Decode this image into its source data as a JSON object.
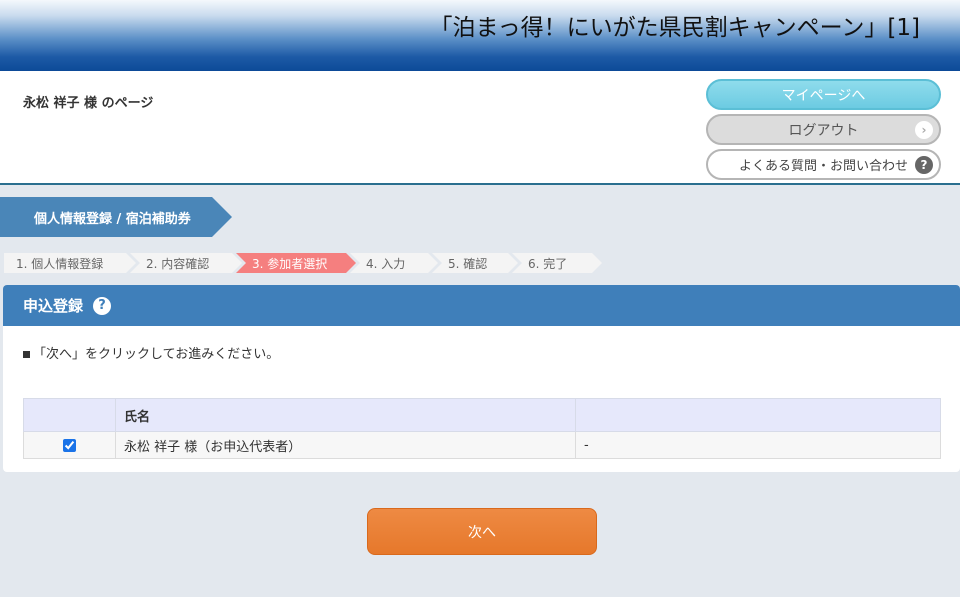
{
  "header": {
    "title": "「泊まっ得！にいがた県民割キャンペーン」[1]"
  },
  "user": {
    "name_label": "永松 祥子 様 のページ",
    "mypage_button": "マイページへ",
    "logout_button": "ログアウト",
    "faq_button": "よくある質問・お問い合わせ"
  },
  "section": {
    "label": "個人情報登録 / 宿泊補助券"
  },
  "steps": [
    {
      "label": "1. 個人情報登録"
    },
    {
      "label": "2. 内容確認"
    },
    {
      "label": "3. 参加者選択",
      "active": true
    },
    {
      "label": "4. 入力"
    },
    {
      "label": "5. 確認"
    },
    {
      "label": "6. 完了"
    }
  ],
  "form": {
    "title": "申込登録",
    "instruction": "「次へ」をクリックしてお進みください。",
    "columns": [
      "",
      "氏名",
      ""
    ],
    "rows": [
      {
        "checked": true,
        "name": "永松 祥子 様（お申込代表者）",
        "extra": "-"
      }
    ]
  },
  "next_button": "次へ",
  "colors": {
    "primary": "#3f7fba",
    "active_step": "#f57f7f",
    "next_button": "#e8792f"
  }
}
